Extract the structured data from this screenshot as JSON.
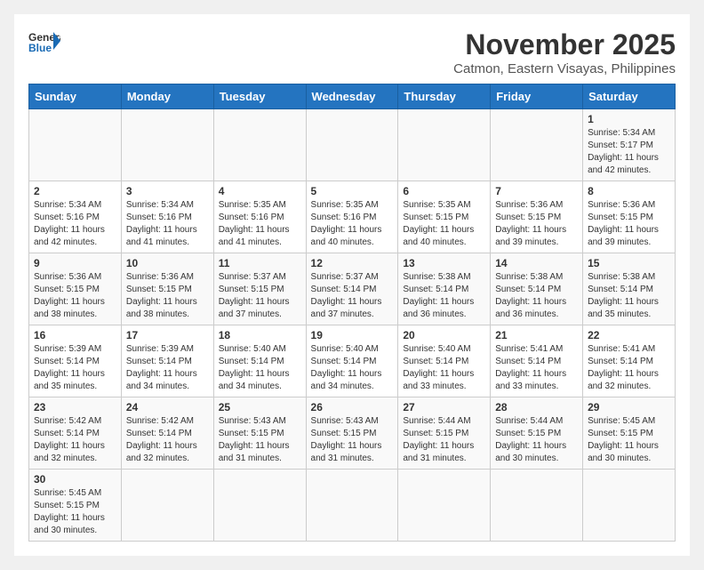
{
  "header": {
    "logo_line1": "General",
    "logo_line2": "Blue",
    "month_year": "November 2025",
    "location": "Catmon, Eastern Visayas, Philippines"
  },
  "weekdays": [
    "Sunday",
    "Monday",
    "Tuesday",
    "Wednesday",
    "Thursday",
    "Friday",
    "Saturday"
  ],
  "weeks": [
    [
      {
        "day": "",
        "info": ""
      },
      {
        "day": "",
        "info": ""
      },
      {
        "day": "",
        "info": ""
      },
      {
        "day": "",
        "info": ""
      },
      {
        "day": "",
        "info": ""
      },
      {
        "day": "",
        "info": ""
      },
      {
        "day": "1",
        "info": "Sunrise: 5:34 AM\nSunset: 5:17 PM\nDaylight: 11 hours\nand 42 minutes."
      }
    ],
    [
      {
        "day": "2",
        "info": "Sunrise: 5:34 AM\nSunset: 5:16 PM\nDaylight: 11 hours\nand 42 minutes."
      },
      {
        "day": "3",
        "info": "Sunrise: 5:34 AM\nSunset: 5:16 PM\nDaylight: 11 hours\nand 41 minutes."
      },
      {
        "day": "4",
        "info": "Sunrise: 5:35 AM\nSunset: 5:16 PM\nDaylight: 11 hours\nand 41 minutes."
      },
      {
        "day": "5",
        "info": "Sunrise: 5:35 AM\nSunset: 5:16 PM\nDaylight: 11 hours\nand 40 minutes."
      },
      {
        "day": "6",
        "info": "Sunrise: 5:35 AM\nSunset: 5:15 PM\nDaylight: 11 hours\nand 40 minutes."
      },
      {
        "day": "7",
        "info": "Sunrise: 5:36 AM\nSunset: 5:15 PM\nDaylight: 11 hours\nand 39 minutes."
      },
      {
        "day": "8",
        "info": "Sunrise: 5:36 AM\nSunset: 5:15 PM\nDaylight: 11 hours\nand 39 minutes."
      }
    ],
    [
      {
        "day": "9",
        "info": "Sunrise: 5:36 AM\nSunset: 5:15 PM\nDaylight: 11 hours\nand 38 minutes."
      },
      {
        "day": "10",
        "info": "Sunrise: 5:36 AM\nSunset: 5:15 PM\nDaylight: 11 hours\nand 38 minutes."
      },
      {
        "day": "11",
        "info": "Sunrise: 5:37 AM\nSunset: 5:15 PM\nDaylight: 11 hours\nand 37 minutes."
      },
      {
        "day": "12",
        "info": "Sunrise: 5:37 AM\nSunset: 5:14 PM\nDaylight: 11 hours\nand 37 minutes."
      },
      {
        "day": "13",
        "info": "Sunrise: 5:38 AM\nSunset: 5:14 PM\nDaylight: 11 hours\nand 36 minutes."
      },
      {
        "day": "14",
        "info": "Sunrise: 5:38 AM\nSunset: 5:14 PM\nDaylight: 11 hours\nand 36 minutes."
      },
      {
        "day": "15",
        "info": "Sunrise: 5:38 AM\nSunset: 5:14 PM\nDaylight: 11 hours\nand 35 minutes."
      }
    ],
    [
      {
        "day": "16",
        "info": "Sunrise: 5:39 AM\nSunset: 5:14 PM\nDaylight: 11 hours\nand 35 minutes."
      },
      {
        "day": "17",
        "info": "Sunrise: 5:39 AM\nSunset: 5:14 PM\nDaylight: 11 hours\nand 34 minutes."
      },
      {
        "day": "18",
        "info": "Sunrise: 5:40 AM\nSunset: 5:14 PM\nDaylight: 11 hours\nand 34 minutes."
      },
      {
        "day": "19",
        "info": "Sunrise: 5:40 AM\nSunset: 5:14 PM\nDaylight: 11 hours\nand 34 minutes."
      },
      {
        "day": "20",
        "info": "Sunrise: 5:40 AM\nSunset: 5:14 PM\nDaylight: 11 hours\nand 33 minutes."
      },
      {
        "day": "21",
        "info": "Sunrise: 5:41 AM\nSunset: 5:14 PM\nDaylight: 11 hours\nand 33 minutes."
      },
      {
        "day": "22",
        "info": "Sunrise: 5:41 AM\nSunset: 5:14 PM\nDaylight: 11 hours\nand 32 minutes."
      }
    ],
    [
      {
        "day": "23",
        "info": "Sunrise: 5:42 AM\nSunset: 5:14 PM\nDaylight: 11 hours\nand 32 minutes."
      },
      {
        "day": "24",
        "info": "Sunrise: 5:42 AM\nSunset: 5:14 PM\nDaylight: 11 hours\nand 32 minutes."
      },
      {
        "day": "25",
        "info": "Sunrise: 5:43 AM\nSunset: 5:15 PM\nDaylight: 11 hours\nand 31 minutes."
      },
      {
        "day": "26",
        "info": "Sunrise: 5:43 AM\nSunset: 5:15 PM\nDaylight: 11 hours\nand 31 minutes."
      },
      {
        "day": "27",
        "info": "Sunrise: 5:44 AM\nSunset: 5:15 PM\nDaylight: 11 hours\nand 31 minutes."
      },
      {
        "day": "28",
        "info": "Sunrise: 5:44 AM\nSunset: 5:15 PM\nDaylight: 11 hours\nand 30 minutes."
      },
      {
        "day": "29",
        "info": "Sunrise: 5:45 AM\nSunset: 5:15 PM\nDaylight: 11 hours\nand 30 minutes."
      }
    ],
    [
      {
        "day": "30",
        "info": "Sunrise: 5:45 AM\nSunset: 5:15 PM\nDaylight: 11 hours\nand 30 minutes."
      },
      {
        "day": "",
        "info": ""
      },
      {
        "day": "",
        "info": ""
      },
      {
        "day": "",
        "info": ""
      },
      {
        "day": "",
        "info": ""
      },
      {
        "day": "",
        "info": ""
      },
      {
        "day": "",
        "info": ""
      }
    ]
  ]
}
